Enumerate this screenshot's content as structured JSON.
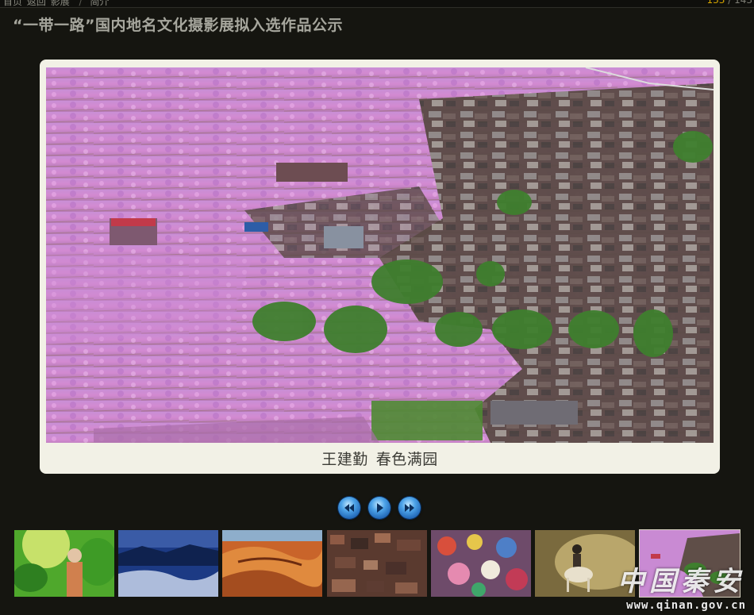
{
  "topbar": {
    "breadcrumbs": [
      "首页",
      "返回",
      "影展",
      "简介"
    ],
    "current_index": "133",
    "separator": "/",
    "total": "143"
  },
  "page": {
    "title": "“一带一路”国内地名文化摄影展拟入选作品公示"
  },
  "viewer": {
    "author": "王建勤",
    "work_title": "春色满园"
  },
  "controls": {
    "prev_icon": "rewind-icon",
    "play_icon": "play-icon",
    "next_icon": "fast-forward-icon",
    "color": "#2f7fd4"
  },
  "thumbnails": [
    {
      "subject": "woman-in-green-foliage"
    },
    {
      "subject": "blue-mountain-sea-of-clouds"
    },
    {
      "subject": "desert-sand-dunes"
    },
    {
      "subject": "red-brick-village-aerial"
    },
    {
      "subject": "colorful-market-crowd"
    },
    {
      "subject": "horseman-in-dust"
    },
    {
      "subject": "pink-blossom-village",
      "selected": true
    }
  ],
  "watermark": {
    "logo_text": "中国秦安",
    "url": "www.qinan.gov.cn"
  },
  "colors": {
    "background": "#151510",
    "frame": "#f2f1e6",
    "accent": "#d7a600"
  }
}
